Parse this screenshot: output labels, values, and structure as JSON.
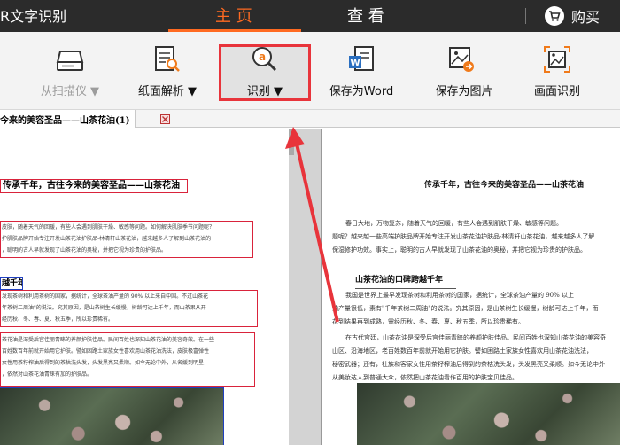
{
  "app": {
    "title": "R文字识别"
  },
  "nav": {
    "tabs": [
      {
        "label": "主 页",
        "active": true
      },
      {
        "label": "查 看",
        "active": false
      }
    ],
    "cart_label": "购买",
    "accent_color": "#ff6a21"
  },
  "toolbar": {
    "scan": {
      "label": "从扫描仪 ▼",
      "icon": "scanner-icon",
      "enabled": false
    },
    "parse": {
      "label": "纸面解析 ▼",
      "icon": "page-search-icon"
    },
    "recognize": {
      "label": "识别 ▼",
      "icon": "ocr-magnifier-icon",
      "highlighted": true,
      "highlight_color": "#e8343b"
    },
    "save_word": {
      "label": "保存为Word",
      "icon": "word-document-icon"
    },
    "save_image": {
      "label": "保存为图片",
      "icon": "save-image-icon"
    },
    "screen_ocr": {
      "label": "画面识别",
      "icon": "screen-picture-icon"
    }
  },
  "document_tab": {
    "title": "今来的美容圣品——山茶花油(1)"
  },
  "left_page": {
    "title": "传承千年，古往今来的美容圣品——山茶花油",
    "para1": [
      "皮肤，随着天气的回暖，有些人会遇到肌肤干燥、敏感等问题。如何解决肌肤季节问题呢？",
      "护肌肤品牌开始专注开发山茶花油护肤品-林清轩山茶花油，越来越多人了解到山茶花油的",
      "，聪明的古人早就发现了山茶花油的奥秘，并把它视为珍贵的护肤品。"
    ],
    "heading2": "越千年",
    "para2": [
      "发现茶树和利用茶树的国家，据统计，全球茶油产量的 90% 以上来自中国。不过山茶花",
      "年茶树二周油\"的说法。究其原因，是山茶树生长缓慢，树龄可达上千年，而山茶果从开",
      "经历秋、冬、春、夏、秋五季，所以珍贵稀有。",
      "茶花油是深受后宫佳丽青睐的养颜护肤佳品。民间百姓也深知山茶花油的美容奇效。在一些",
      "百姓数百年前就开始用它护肤。譬如困路土家族女性喜欢用山茶花油洗法，皮肤极富弹性",
      "女性用茶籽榨油后得到的茶枯洗头发，头发黑亮又柔顺。如今无论中外，从名媛到明星，",
      "，依然对山茶花油青睐有加的护肤品。"
    ]
  },
  "right_page": {
    "title": "传承千年，古往今来的美容圣品——山茶花油",
    "para1": [
      "春日大地，万物复苏，随着天气的回暖，有些人会遇到肌肤干燥、敏感等问题。",
      "题呢？越来越一些高端护肤品牌开始专注开发山茶花油护肤品-林清轩山茶花油，越来越多人了解",
      "保湿修护功效。事实上，聪明的古人早就发现了山茶花油的奥秘，并把它视为珍贵的护肤品。"
    ],
    "heading2": "山茶花油的口碑跨越千年",
    "para2": [
      "我国是世界上最早发现茶树和利用茶树的国家，据统计，全球茶油产量的 90% 以上",
      "油产量很低，素有\"千年茶树二周油\"的说法。究其原因，是山茶树生长缓慢，树龄可达上千年，而",
      "花到结果再到成熟，需经历秋、冬、春、夏、秋五季，所以珍贵稀有。",
      "在古代宫廷，山茶花油是深受后宫佳丽青睐的养颜护肤佳品。民间百姓也深知山茶花油的美容奇",
      "山区、沿海地区，老百姓数百年前就开始用它护肤。譬如困路土家族女性喜欢用山茶花油洗法，",
      "秘密武器；还有，社族和客家女性用茶籽榨油后得到的茶枯洗头发，头发黑亮又柔顺。如今无论中外",
      "从美妆达人到普通大众，依然把山茶花油看作百用的护肤宝贝佳品。"
    ]
  }
}
